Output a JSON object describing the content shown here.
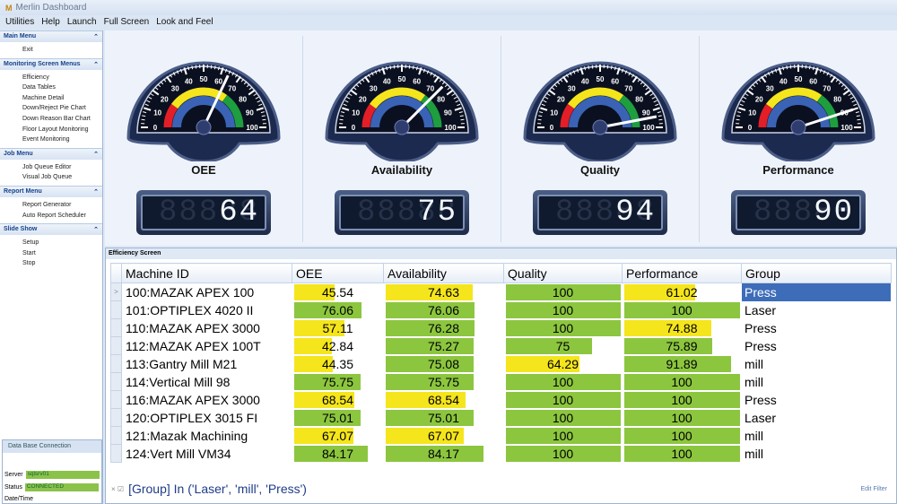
{
  "window": {
    "title": "Merlin Dashboard",
    "logo": "M"
  },
  "menubar": [
    "Utilities",
    "Help",
    "Launch",
    "Full Screen",
    "Look and Feel"
  ],
  "sidebar": [
    {
      "title": "Main Menu",
      "items": [
        "Exit"
      ]
    },
    {
      "title": "Monitoring Screen Menus",
      "items": [
        "Efficiency",
        "Data Tables",
        "Machine Detail",
        "Down/Reject Pie Chart",
        "Down Reason Bar Chart",
        "Floor Layout Monitoring",
        "Event Monitoring"
      ]
    },
    {
      "title": "Job Menu",
      "items": [
        "Job Queue Editor",
        "Visual Job Queue"
      ]
    },
    {
      "title": "Report Menu",
      "items": [
        "Report Generator",
        "Auto Report Scheduler"
      ]
    },
    {
      "title": "Slide Show",
      "items": [
        "Setup",
        "Start",
        "Stop"
      ]
    }
  ],
  "db": {
    "title": "Data Base Connection",
    "server_label": "Server",
    "server": "sqlsrv01",
    "status_label": "Status",
    "status": "CONNECTED",
    "datetime_label": "Date/Time"
  },
  "gauges": [
    {
      "label": "OEE",
      "value": 64,
      "display": "64"
    },
    {
      "label": "Availability",
      "value": 75,
      "display": "75"
    },
    {
      "label": "Quality",
      "value": 94,
      "display": "94"
    },
    {
      "label": "Performance",
      "value": 90,
      "display": "90"
    }
  ],
  "gauge_ticks": [
    "0",
    "10",
    "20",
    "30",
    "40",
    "50",
    "60",
    "70",
    "80",
    "90",
    "100"
  ],
  "colors": {
    "yellow": "#f5e51c",
    "green": "#8cc63f",
    "select": "#3d6cb9"
  },
  "grid": {
    "caption": "Efficiency Screen",
    "columns": [
      "Machine ID",
      "OEE",
      "Availability",
      "Quality",
      "Performance",
      "Group"
    ],
    "rows": [
      [
        "100:MAZAK APEX 100",
        "45.54",
        "74.63",
        "100",
        "61.02",
        "Press"
      ],
      [
        "101:OPTIPLEX 4020 II",
        "76.06",
        "76.06",
        "100",
        "100",
        "Laser"
      ],
      [
        "110:MAZAK APEX 3000",
        "57.11",
        "76.28",
        "100",
        "74.88",
        "Press"
      ],
      [
        "112:MAZAK APEX 100T",
        "42.84",
        "75.27",
        "75",
        "75.89",
        "Press"
      ],
      [
        "113:Gantry Mill M21",
        "44.35",
        "75.08",
        "64.29",
        "91.89",
        "mill"
      ],
      [
        "114:Vertical Mill 98",
        "75.75",
        "75.75",
        "100",
        "100",
        "mill"
      ],
      [
        "116:MAZAK APEX 3000",
        "68.54",
        "68.54",
        "100",
        "100",
        "Press"
      ],
      [
        "120:OPTIPLEX 3015 FI",
        "75.01",
        "75.01",
        "100",
        "100",
        "Laser"
      ],
      [
        "121:Mazak Machining",
        "67.07",
        "67.07",
        "100",
        "100",
        "mill"
      ],
      [
        "124:Vert Mill VM34",
        "84.17",
        "84.17",
        "100",
        "100",
        "mill"
      ]
    ],
    "filter": "[Group] In ('Laser', 'mill', 'Press')",
    "edit_filter": "Edit Filter",
    "row_indicator": ">"
  }
}
